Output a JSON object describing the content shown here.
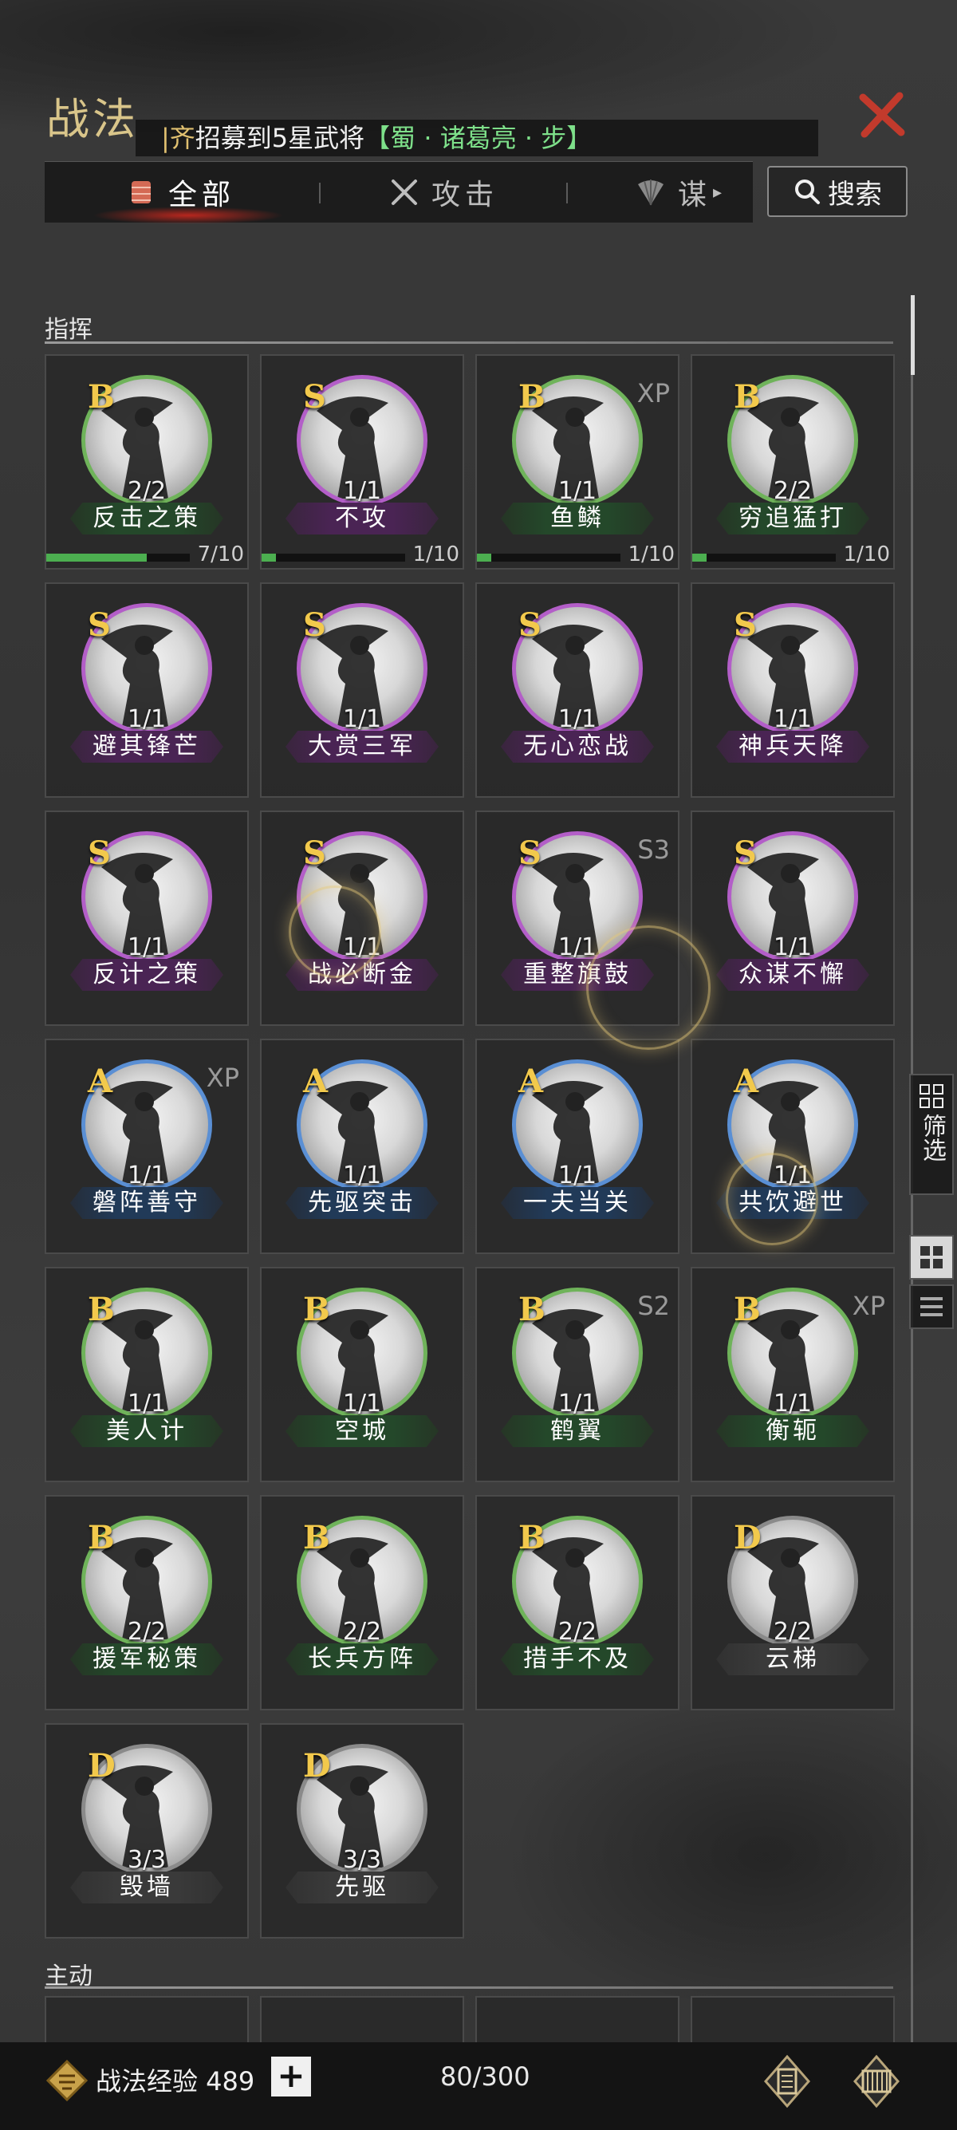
{
  "title": "战法",
  "ticker": {
    "prefix": "|齐",
    "text": "招募到5星武将",
    "bracket_open": "【",
    "hero": "蜀 · 诸葛亮 · 步",
    "bracket_close": "】"
  },
  "tabs": [
    {
      "label": "全部",
      "icon": "scroll-bundle-icon",
      "active": true
    },
    {
      "label": "攻击",
      "icon": "crossed-swords-icon",
      "active": false
    },
    {
      "label": "谋",
      "icon": "fan-icon",
      "active": false
    }
  ],
  "search_label": "搜索",
  "sections": [
    {
      "label": "指挥"
    },
    {
      "label": "主动"
    }
  ],
  "cards": [
    {
      "grade": "B",
      "count": "2/2",
      "name": "反击之策",
      "corner": "",
      "progress": "7/10",
      "progress_value": 0.7
    },
    {
      "grade": "S",
      "count": "1/1",
      "name": "不攻",
      "corner": "",
      "progress": "1/10",
      "progress_value": 0.1
    },
    {
      "grade": "B",
      "count": "1/1",
      "name": "鱼鳞",
      "corner": "XP",
      "progress": "1/10",
      "progress_value": 0.1
    },
    {
      "grade": "B",
      "count": "2/2",
      "name": "穷追猛打",
      "corner": "",
      "progress": "1/10",
      "progress_value": 0.1
    },
    {
      "grade": "S",
      "count": "1/1",
      "name": "避其锋芒",
      "corner": ""
    },
    {
      "grade": "S",
      "count": "1/1",
      "name": "大赏三军",
      "corner": ""
    },
    {
      "grade": "S",
      "count": "1/1",
      "name": "无心恋战",
      "corner": ""
    },
    {
      "grade": "S",
      "count": "1/1",
      "name": "神兵天降",
      "corner": ""
    },
    {
      "grade": "S",
      "count": "1/1",
      "name": "反计之策",
      "corner": ""
    },
    {
      "grade": "S",
      "count": "1/1",
      "name": "战必断金",
      "corner": ""
    },
    {
      "grade": "S",
      "count": "1/1",
      "name": "重整旗鼓",
      "corner": "S3"
    },
    {
      "grade": "S",
      "count": "1/1",
      "name": "众谋不懈",
      "corner": ""
    },
    {
      "grade": "A",
      "count": "1/1",
      "name": "磐阵善守",
      "corner": "XP"
    },
    {
      "grade": "A",
      "count": "1/1",
      "name": "先驱突击",
      "corner": ""
    },
    {
      "grade": "A",
      "count": "1/1",
      "name": "一夫当关",
      "corner": ""
    },
    {
      "grade": "A",
      "count": "1/1",
      "name": "共饮避世",
      "corner": ""
    },
    {
      "grade": "B",
      "count": "1/1",
      "name": "美人计",
      "corner": ""
    },
    {
      "grade": "B",
      "count": "1/1",
      "name": "空城",
      "corner": ""
    },
    {
      "grade": "B",
      "count": "1/1",
      "name": "鹤翼",
      "corner": "S2"
    },
    {
      "grade": "B",
      "count": "1/1",
      "name": "衡轭",
      "corner": "XP"
    },
    {
      "grade": "B",
      "count": "2/2",
      "name": "援军秘策",
      "corner": ""
    },
    {
      "grade": "B",
      "count": "2/2",
      "name": "长兵方阵",
      "corner": ""
    },
    {
      "grade": "B",
      "count": "2/2",
      "name": "措手不及",
      "corner": ""
    },
    {
      "grade": "D",
      "count": "2/2",
      "name": "云梯",
      "corner": ""
    },
    {
      "grade": "D",
      "count": "3/3",
      "name": "毁墙",
      "corner": ""
    },
    {
      "grade": "D",
      "count": "3/3",
      "name": "先驱",
      "corner": ""
    }
  ],
  "side_filter_label": "筛选",
  "bottom": {
    "exp_label": "战法经验 489",
    "plus": "+",
    "capacity": "80/300"
  },
  "colors": {
    "S": "#b35ec8",
    "A": "#5a8fd4",
    "B": "#6fb35a",
    "D": "#8a8a8a",
    "grade_text": "#f2c94c",
    "title": "#d9c58a",
    "close": "#c23a2c"
  }
}
